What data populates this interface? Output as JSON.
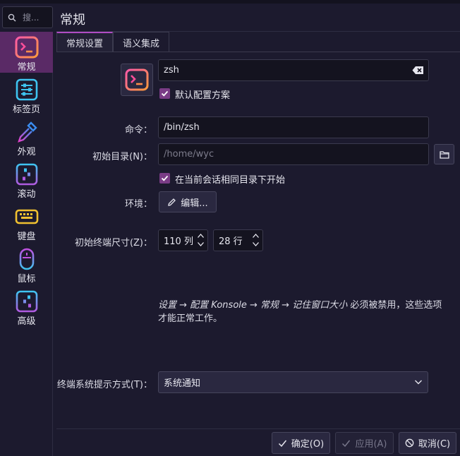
{
  "search": {
    "placeholder": "搜..."
  },
  "header": {
    "title": "常规"
  },
  "sidebar": {
    "items": [
      {
        "label": "常规",
        "icon": "terminal-icon",
        "active": true
      },
      {
        "label": "标签页",
        "icon": "sliders-icon"
      },
      {
        "label": "外观",
        "icon": "eyedropper-icon"
      },
      {
        "label": "滚动",
        "icon": "sliders-icon"
      },
      {
        "label": "键盘",
        "icon": "keyboard-icon"
      },
      {
        "label": "鼠标",
        "icon": "mouse-icon"
      },
      {
        "label": "高级",
        "icon": "sliders-icon"
      }
    ]
  },
  "tabs": [
    {
      "label": "常规设置",
      "active": true
    },
    {
      "label": "语义集成",
      "active": false
    }
  ],
  "profile": {
    "name_value": "zsh",
    "default_profile_label": "默认配置方案",
    "default_profile_checked": true
  },
  "form": {
    "command_label": "命令：",
    "command_value": "/bin/zsh",
    "initial_dir_label": "初始目录(N)：",
    "initial_dir_placeholder": "/home/wyc",
    "same_dir_label": "在当前会话相同目录下开始",
    "same_dir_checked": true,
    "env_label": "环境：",
    "env_button": "编辑...",
    "size_label": "初始终端尺寸(Z)：",
    "cols_value": "110 列",
    "rows_value": "28 行",
    "note_parts": [
      "设置 → 配置 Konsole → 常规 → 记住窗口大小",
      " 必须被禁用，这些选项才能正常工作。"
    ],
    "bell_label": "终端系统提示方式(T)：",
    "bell_value": "系统通知"
  },
  "buttons": {
    "ok": "确定(O)",
    "apply": "应用(A)",
    "cancel": "取消(C)"
  },
  "colors": {
    "background": "#1c1a2e",
    "accent": "#b04cc4",
    "active_sidebar": "#5a2a66",
    "checkbox": "#7a3c86"
  }
}
